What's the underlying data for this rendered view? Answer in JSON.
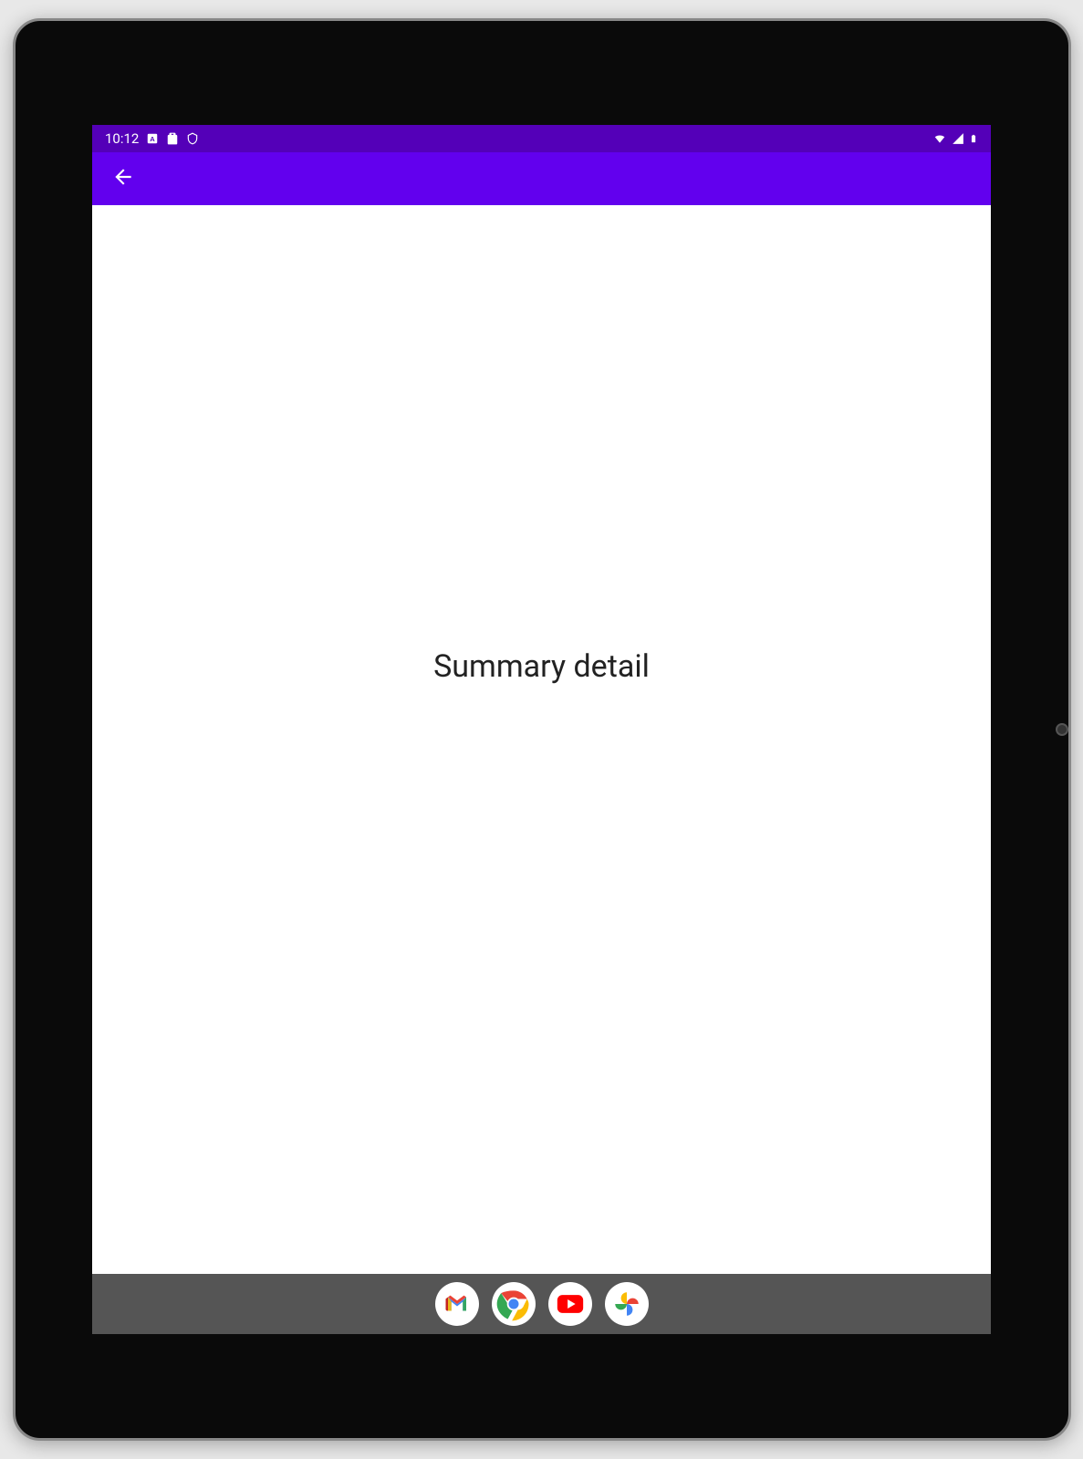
{
  "status_bar": {
    "time": "10:12",
    "icons": {
      "left1": "keyboard-icon",
      "left2": "clipboard-icon",
      "left3": "security-icon",
      "right1": "wifi-icon",
      "right2": "signal-icon",
      "right3": "battery-icon"
    }
  },
  "action_bar": {
    "back_label": "Back"
  },
  "content": {
    "text": "Summary detail"
  },
  "nav_bar": {
    "apps": {
      "gmail": "Gmail",
      "chrome": "Chrome",
      "youtube": "YouTube",
      "photos": "Photos"
    }
  },
  "colors": {
    "status_bar_bg": "#5400b8",
    "action_bar_bg": "#6200EE",
    "nav_bar_bg": "#555555"
  }
}
